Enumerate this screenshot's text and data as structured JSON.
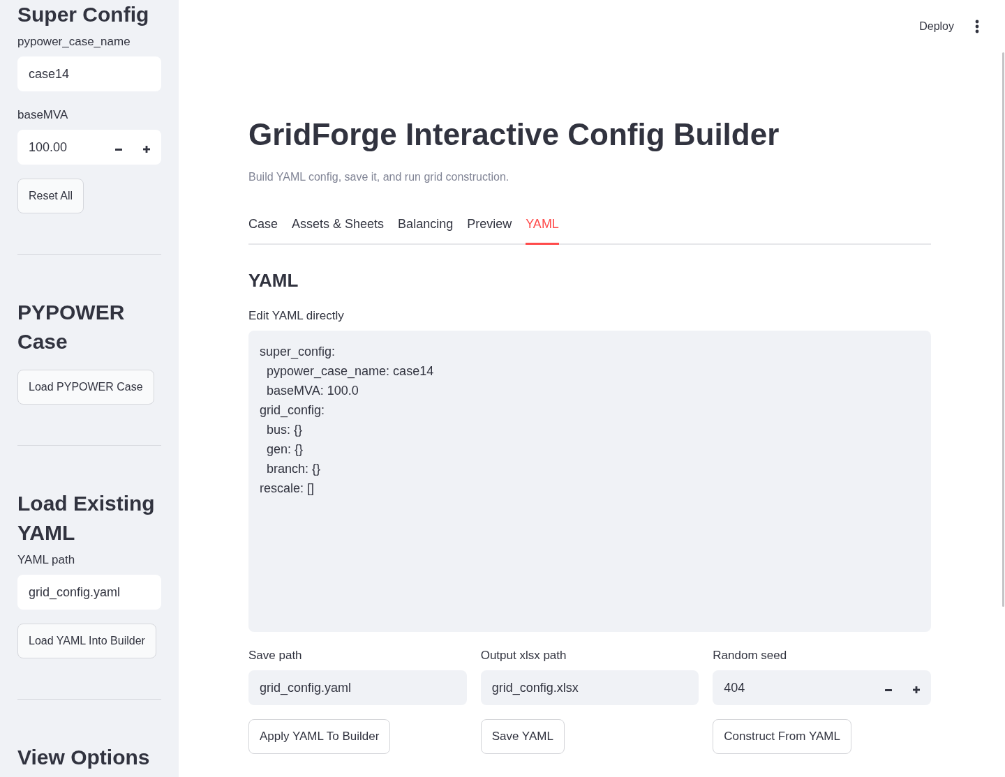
{
  "header": {
    "deploy_label": "Deploy"
  },
  "sidebar": {
    "sections": [
      {
        "heading": "Super Config",
        "controls": [
          {
            "kind": "text_input",
            "label": "pypower_case_name",
            "value": "case14"
          },
          {
            "kind": "number_input",
            "label": "baseMVA",
            "value": "100.00"
          },
          {
            "kind": "button",
            "label": "Reset All"
          }
        ]
      },
      {
        "heading": "PYPOWER Case",
        "controls": [
          {
            "kind": "button",
            "label": "Load PYPOWER Case"
          }
        ]
      },
      {
        "heading": "Load Existing YAML",
        "controls": [
          {
            "kind": "text_input",
            "label": "YAML path",
            "value": "grid_config.yaml"
          },
          {
            "kind": "button",
            "label": "Load YAML Into Builder"
          }
        ]
      },
      {
        "heading": "View Options"
      }
    ]
  },
  "title": "GridForge Interactive Config Builder",
  "subtitle": "Build YAML config, save it, and run grid construction.",
  "tabs": [
    {
      "label": "Case",
      "selected": false
    },
    {
      "label": "Assets & Sheets",
      "selected": false
    },
    {
      "label": "Balancing",
      "selected": false
    },
    {
      "label": "Preview",
      "selected": false
    },
    {
      "label": "YAML",
      "selected": true
    }
  ],
  "panel": {
    "heading": "YAML",
    "editor": {
      "label": "Edit YAML directly",
      "value": "super_config:\n  pypower_case_name: case14\n  baseMVA: 100.0\ngrid_config:\n  bus: {}\n  gen: {}\n  branch: {}\nrescale: []"
    },
    "columns": [
      {
        "controls": [
          {
            "kind": "text_input",
            "label": "Save path",
            "value": "grid_config.yaml"
          },
          {
            "kind": "button",
            "label": "Apply YAML To Builder"
          }
        ]
      },
      {
        "controls": [
          {
            "kind": "text_input",
            "label": "Output xlsx path",
            "value": "grid_config.xlsx"
          },
          {
            "kind": "button",
            "label": "Save YAML"
          }
        ]
      },
      {
        "controls": [
          {
            "kind": "number_input",
            "label": "Random seed",
            "value": "404"
          },
          {
            "kind": "button",
            "label": "Construct From YAML"
          }
        ]
      }
    ]
  }
}
